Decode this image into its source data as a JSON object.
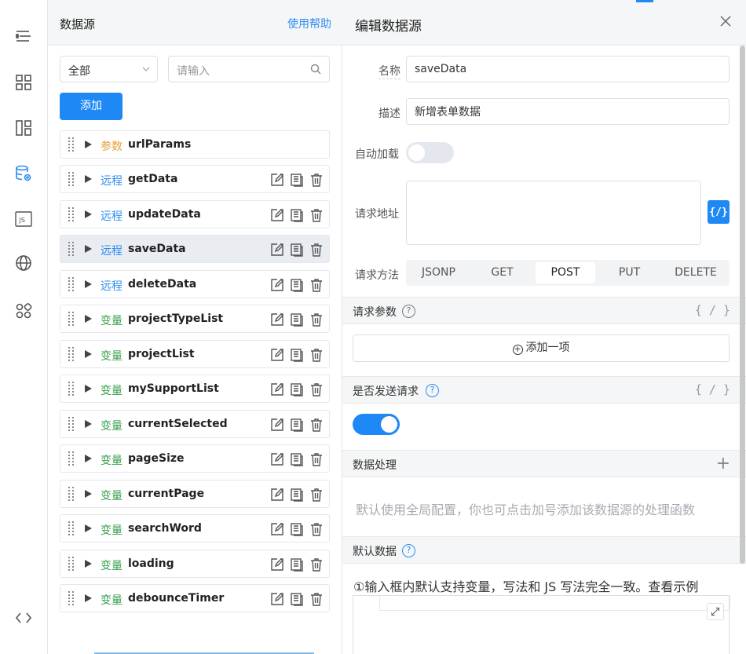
{
  "sidebar": {
    "icons": [
      "outline-icon",
      "components-icon",
      "layout-icon",
      "datasource-icon",
      "js-icon",
      "globe-icon",
      "apps-icon",
      "code-icon"
    ],
    "js_label": "JS"
  },
  "datasource_panel": {
    "title": "数据源",
    "help_link": "使用帮助",
    "filter_value": "全部",
    "search_placeholder": "请输入",
    "add_button": "添加",
    "items": [
      {
        "type": "参数",
        "kind": "param",
        "name": "urlParams"
      },
      {
        "type": "远程",
        "kind": "remote",
        "name": "getData"
      },
      {
        "type": "远程",
        "kind": "remote",
        "name": "updateData"
      },
      {
        "type": "远程",
        "kind": "remote",
        "name": "saveData"
      },
      {
        "type": "远程",
        "kind": "remote",
        "name": "deleteData"
      },
      {
        "type": "变量",
        "kind": "var",
        "name": "projectTypeList"
      },
      {
        "type": "变量",
        "kind": "var",
        "name": "projectList"
      },
      {
        "type": "变量",
        "kind": "var",
        "name": "mySupportList"
      },
      {
        "type": "变量",
        "kind": "var",
        "name": "currentSelected"
      },
      {
        "type": "变量",
        "kind": "var",
        "name": "pageSize"
      },
      {
        "type": "变量",
        "kind": "var",
        "name": "currentPage"
      },
      {
        "type": "变量",
        "kind": "var",
        "name": "searchWord"
      },
      {
        "type": "变量",
        "kind": "var",
        "name": "loading"
      },
      {
        "type": "变量",
        "kind": "var",
        "name": "debounceTimer"
      }
    ]
  },
  "editor": {
    "title": "编辑数据源",
    "name_label": "名称",
    "name_value": "saveData",
    "desc_label": "描述",
    "desc_value": "新增表单数据",
    "autoload_label": "自动加载",
    "url_label": "请求地址",
    "url_value": "",
    "code_button": "{/}",
    "method_label": "请求方法",
    "methods": [
      "JSONP",
      "GET",
      "POST",
      "PUT",
      "DELETE"
    ],
    "selected_method": "POST",
    "params_section": "请求参数",
    "code_symbol": "{ / }",
    "add_item": "添加一项",
    "send_section": "是否发送请求",
    "process_section": "数据处理",
    "process_hint": "默认使用全局配置，你也可点击加号添加该数据源的处理函数",
    "default_section": "默认数据",
    "default_note": "①输入框内默认支持变量，写法和 JS 写法完全一致。查看示例",
    "plus": "+",
    "q": "?"
  }
}
